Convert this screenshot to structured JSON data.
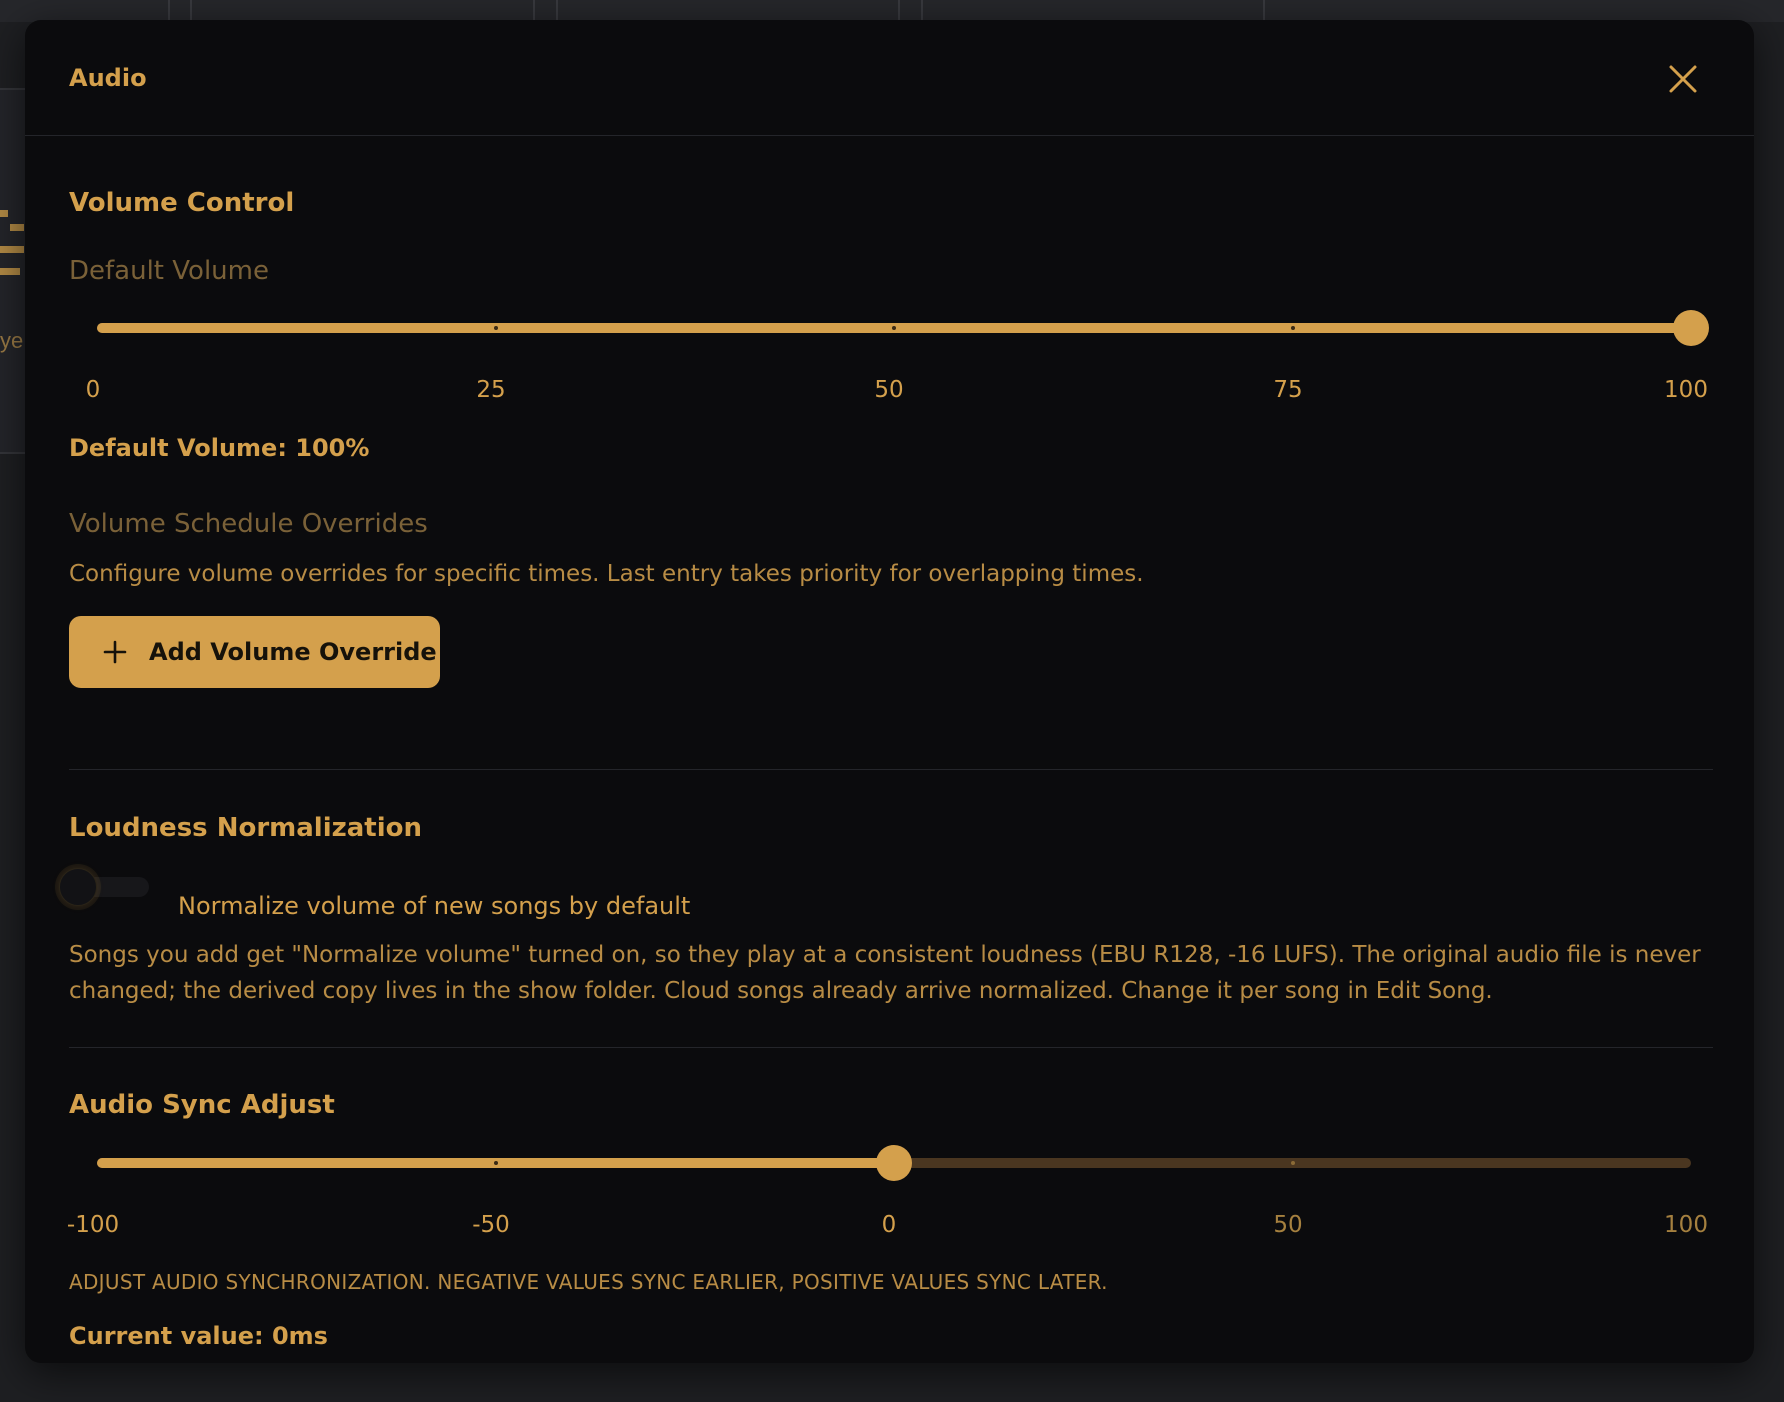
{
  "modal": {
    "title": "Audio"
  },
  "volume_control": {
    "title": "Volume Control",
    "default_volume_heading": "Default Volume",
    "slider": {
      "min": 0,
      "max": 100,
      "value": 100,
      "ticks": [
        "0",
        "25",
        "50",
        "75",
        "100"
      ]
    },
    "status_text": "Default Volume: 100%",
    "overrides_heading": "Volume Schedule Overrides",
    "overrides_description": "Configure volume overrides for specific times. Last entry takes priority for overlapping times.",
    "add_override_label": "Add Volume Override"
  },
  "loudness": {
    "title": "Loudness Normalization",
    "toggle_label": "Normalize volume of new songs by default",
    "toggle_on": false,
    "description": "Songs you add get \"Normalize volume\" turned on, so they play at a consistent loudness (EBU R128, -16 LUFS). The original audio file is never changed; the derived copy lives in the show folder. Cloud songs already arrive normalized. Change it per song in Edit Song."
  },
  "sync": {
    "title": "Audio Sync Adjust",
    "slider": {
      "min": -100,
      "max": 100,
      "value": 0,
      "ticks": [
        "-100",
        "-50",
        "0",
        "50",
        "100"
      ]
    },
    "note": "ADJUST AUDIO SYNCHRONIZATION. NEGATIVE VALUES SYNC EARLIER, POSITIVE VALUES SYNC LATER.",
    "current_value": "Current value: 0ms"
  },
  "colors": {
    "accent": "#d4a04c",
    "background": "#0b0b0d",
    "muted_text": "#7a6138",
    "track_inactive": "#4a3620"
  },
  "icons": {
    "close": "close-icon",
    "add": "plus-icon"
  },
  "background_app": {
    "partial_text": "ye"
  }
}
